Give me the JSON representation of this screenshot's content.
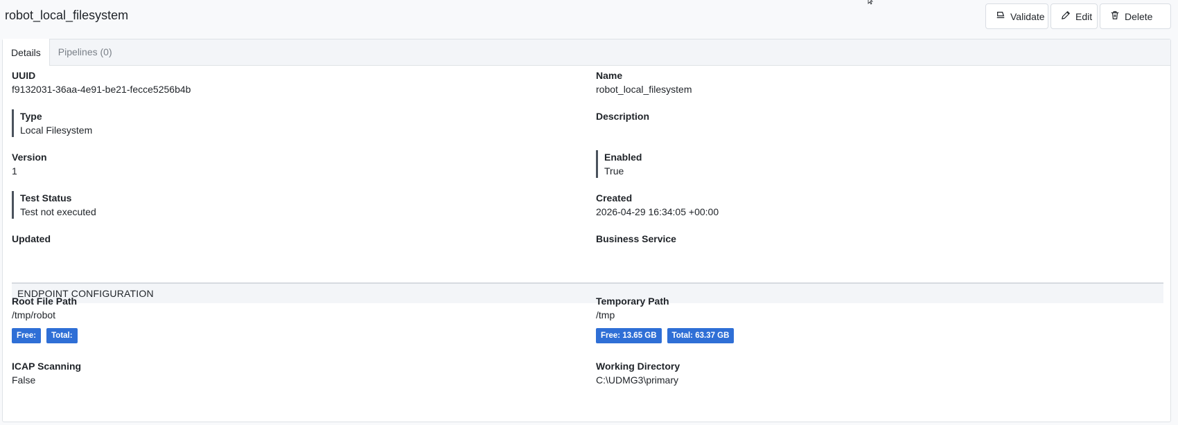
{
  "header": {
    "title": "robot_local_filesystem",
    "validate_label": "Validate",
    "edit_label": "Edit",
    "delete_label": "Delete"
  },
  "tabs": [
    {
      "label": "Details"
    },
    {
      "label": "Pipelines (0)"
    }
  ],
  "details": {
    "uuid_label": "UUID",
    "uuid": "f9132031-36aa-4e91-be21-fecce5256b4b",
    "name_label": "Name",
    "name": "robot_local_filesystem",
    "type_label": "Type",
    "type": "Local Filesystem",
    "description_label": "Description",
    "description": "",
    "version_label": "Version",
    "version": "1",
    "enabled_label": "Enabled",
    "enabled": "True",
    "test_status_label": "Test Status",
    "test_status": "Test not executed",
    "created_label": "Created",
    "created": "2026-04-29 16:34:05 +00:00",
    "updated_label": "Updated",
    "updated": "",
    "business_service_label": "Business Service",
    "business_service": ""
  },
  "endpoint": {
    "section_title": "ENDPOINT CONFIGURATION",
    "root_path_label": "Root File Path",
    "root_path": "/tmp/robot",
    "root_free": "Free:",
    "root_total": "Total:",
    "temp_path_label": "Temporary Path",
    "temp_path": "/tmp",
    "temp_free": "Free: 13.65 GB",
    "temp_total": "Total: 63.37 GB",
    "icap_label": "ICAP Scanning",
    "icap": "False",
    "working_dir_label": "Working Directory",
    "working_dir": "C:\\UDMG3\\primary"
  },
  "colors": {
    "badge": "#2f6fd6",
    "accent_bar": "#4a525c"
  }
}
